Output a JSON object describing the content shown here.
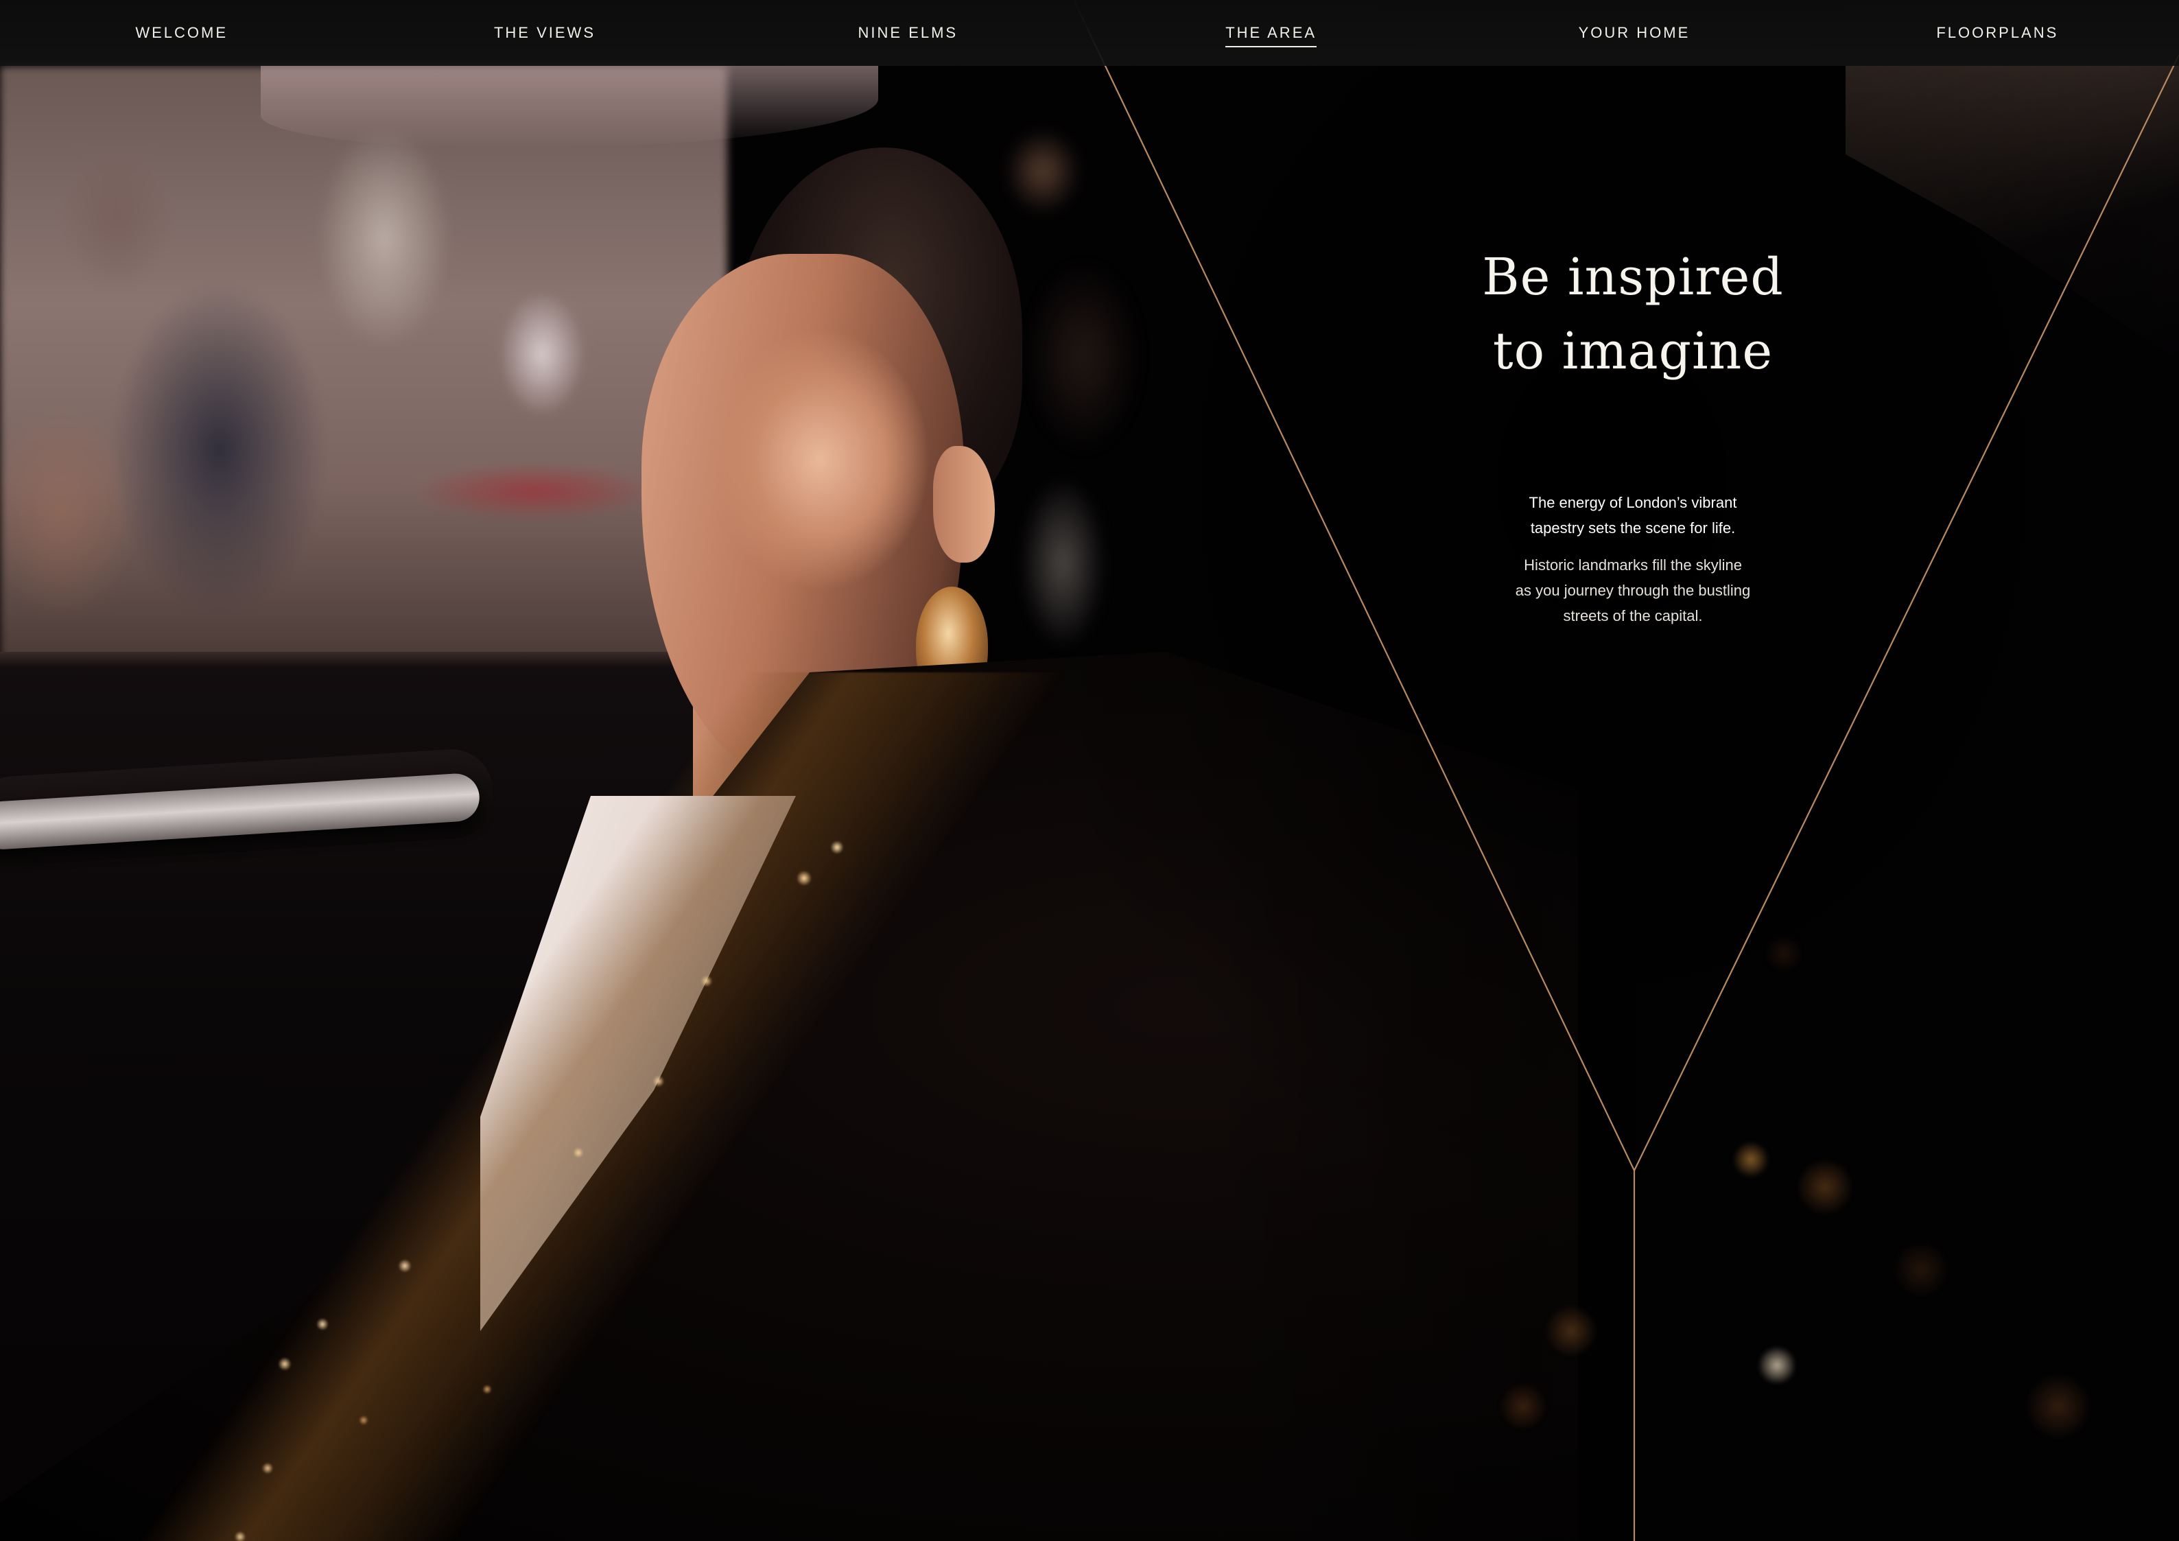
{
  "nav": {
    "items": [
      {
        "label": "WELCOME",
        "active": false
      },
      {
        "label": "THE VIEWS",
        "active": false
      },
      {
        "label": "NINE ELMS",
        "active": false
      },
      {
        "label": "THE AREA",
        "active": true
      },
      {
        "label": "YOUR HOME",
        "active": false
      },
      {
        "label": "FLOORPLANS",
        "active": false
      }
    ]
  },
  "hero": {
    "headline_line1": "Be inspired",
    "headline_line2": "to imagine",
    "intro_line1": "The energy of London’s vibrant",
    "intro_line2": "tapestry sets the scene for life.",
    "body_line1": "Historic landmarks fill the skyline",
    "body_line2": "as you journey through the bustling",
    "body_line3": "streets of the capital."
  },
  "colors": {
    "accent_line": "#b88a62",
    "nav_background": "#111111",
    "text": "#ffffff"
  }
}
